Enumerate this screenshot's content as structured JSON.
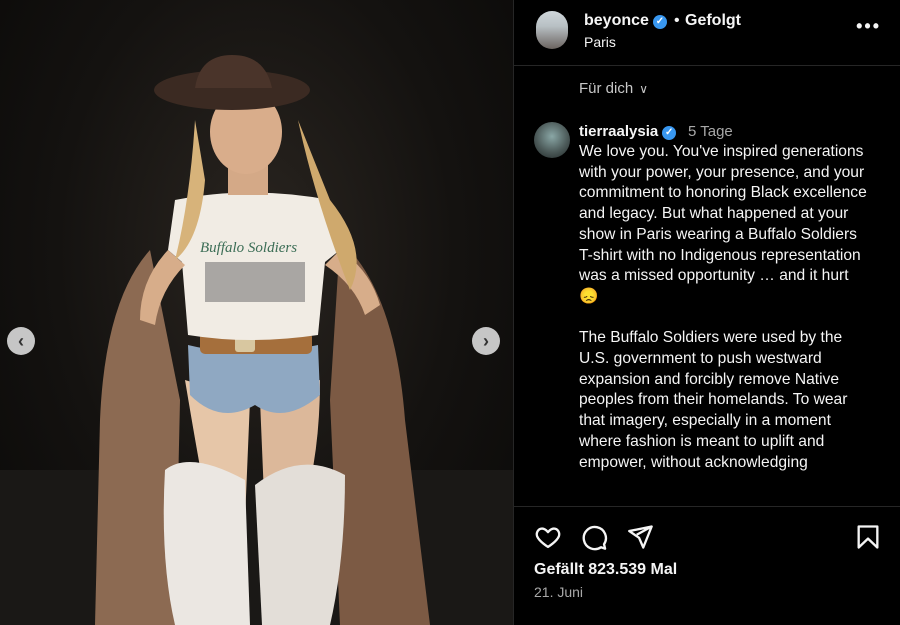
{
  "post": {
    "username": "beyonce",
    "separator": "•",
    "follow_status": "Gefolgt",
    "location": "Paris",
    "more_label": "•••"
  },
  "filter": {
    "label": "Für dich",
    "chevron": "∨"
  },
  "comment": {
    "username": "tierraalysia",
    "time": "5 Tage",
    "text": "We love you. You've inspired generations with your power, your presence, and your commitment to honoring Black excellence and legacy. But what happened at your show in Paris wearing a Buffalo Soldiers T-shirt with no Indigenous representation was a missed opportunity … and it hurt 😞\n\nThe Buffalo Soldiers were used by the U.S. government to push westward expansion and forcibly remove Native peoples from their homelands. To wear that imagery, especially in a moment where fashion is meant to uplift and empower, without acknowledging"
  },
  "engagement": {
    "likes": "Gefällt 823.539 Mal",
    "date": "21. Juni"
  },
  "media": {
    "shirt_text": "Buffalo Soldiers",
    "prev_glyph": "‹",
    "next_glyph": "›"
  },
  "icons": {
    "verified": "verified-badge-icon",
    "like": "heart-icon",
    "comment": "comment-bubble-icon",
    "share": "paper-plane-icon",
    "save": "bookmark-icon"
  },
  "colors": {
    "verified": "#3897f0",
    "background": "#000000",
    "muted": "#a8a8a8"
  }
}
